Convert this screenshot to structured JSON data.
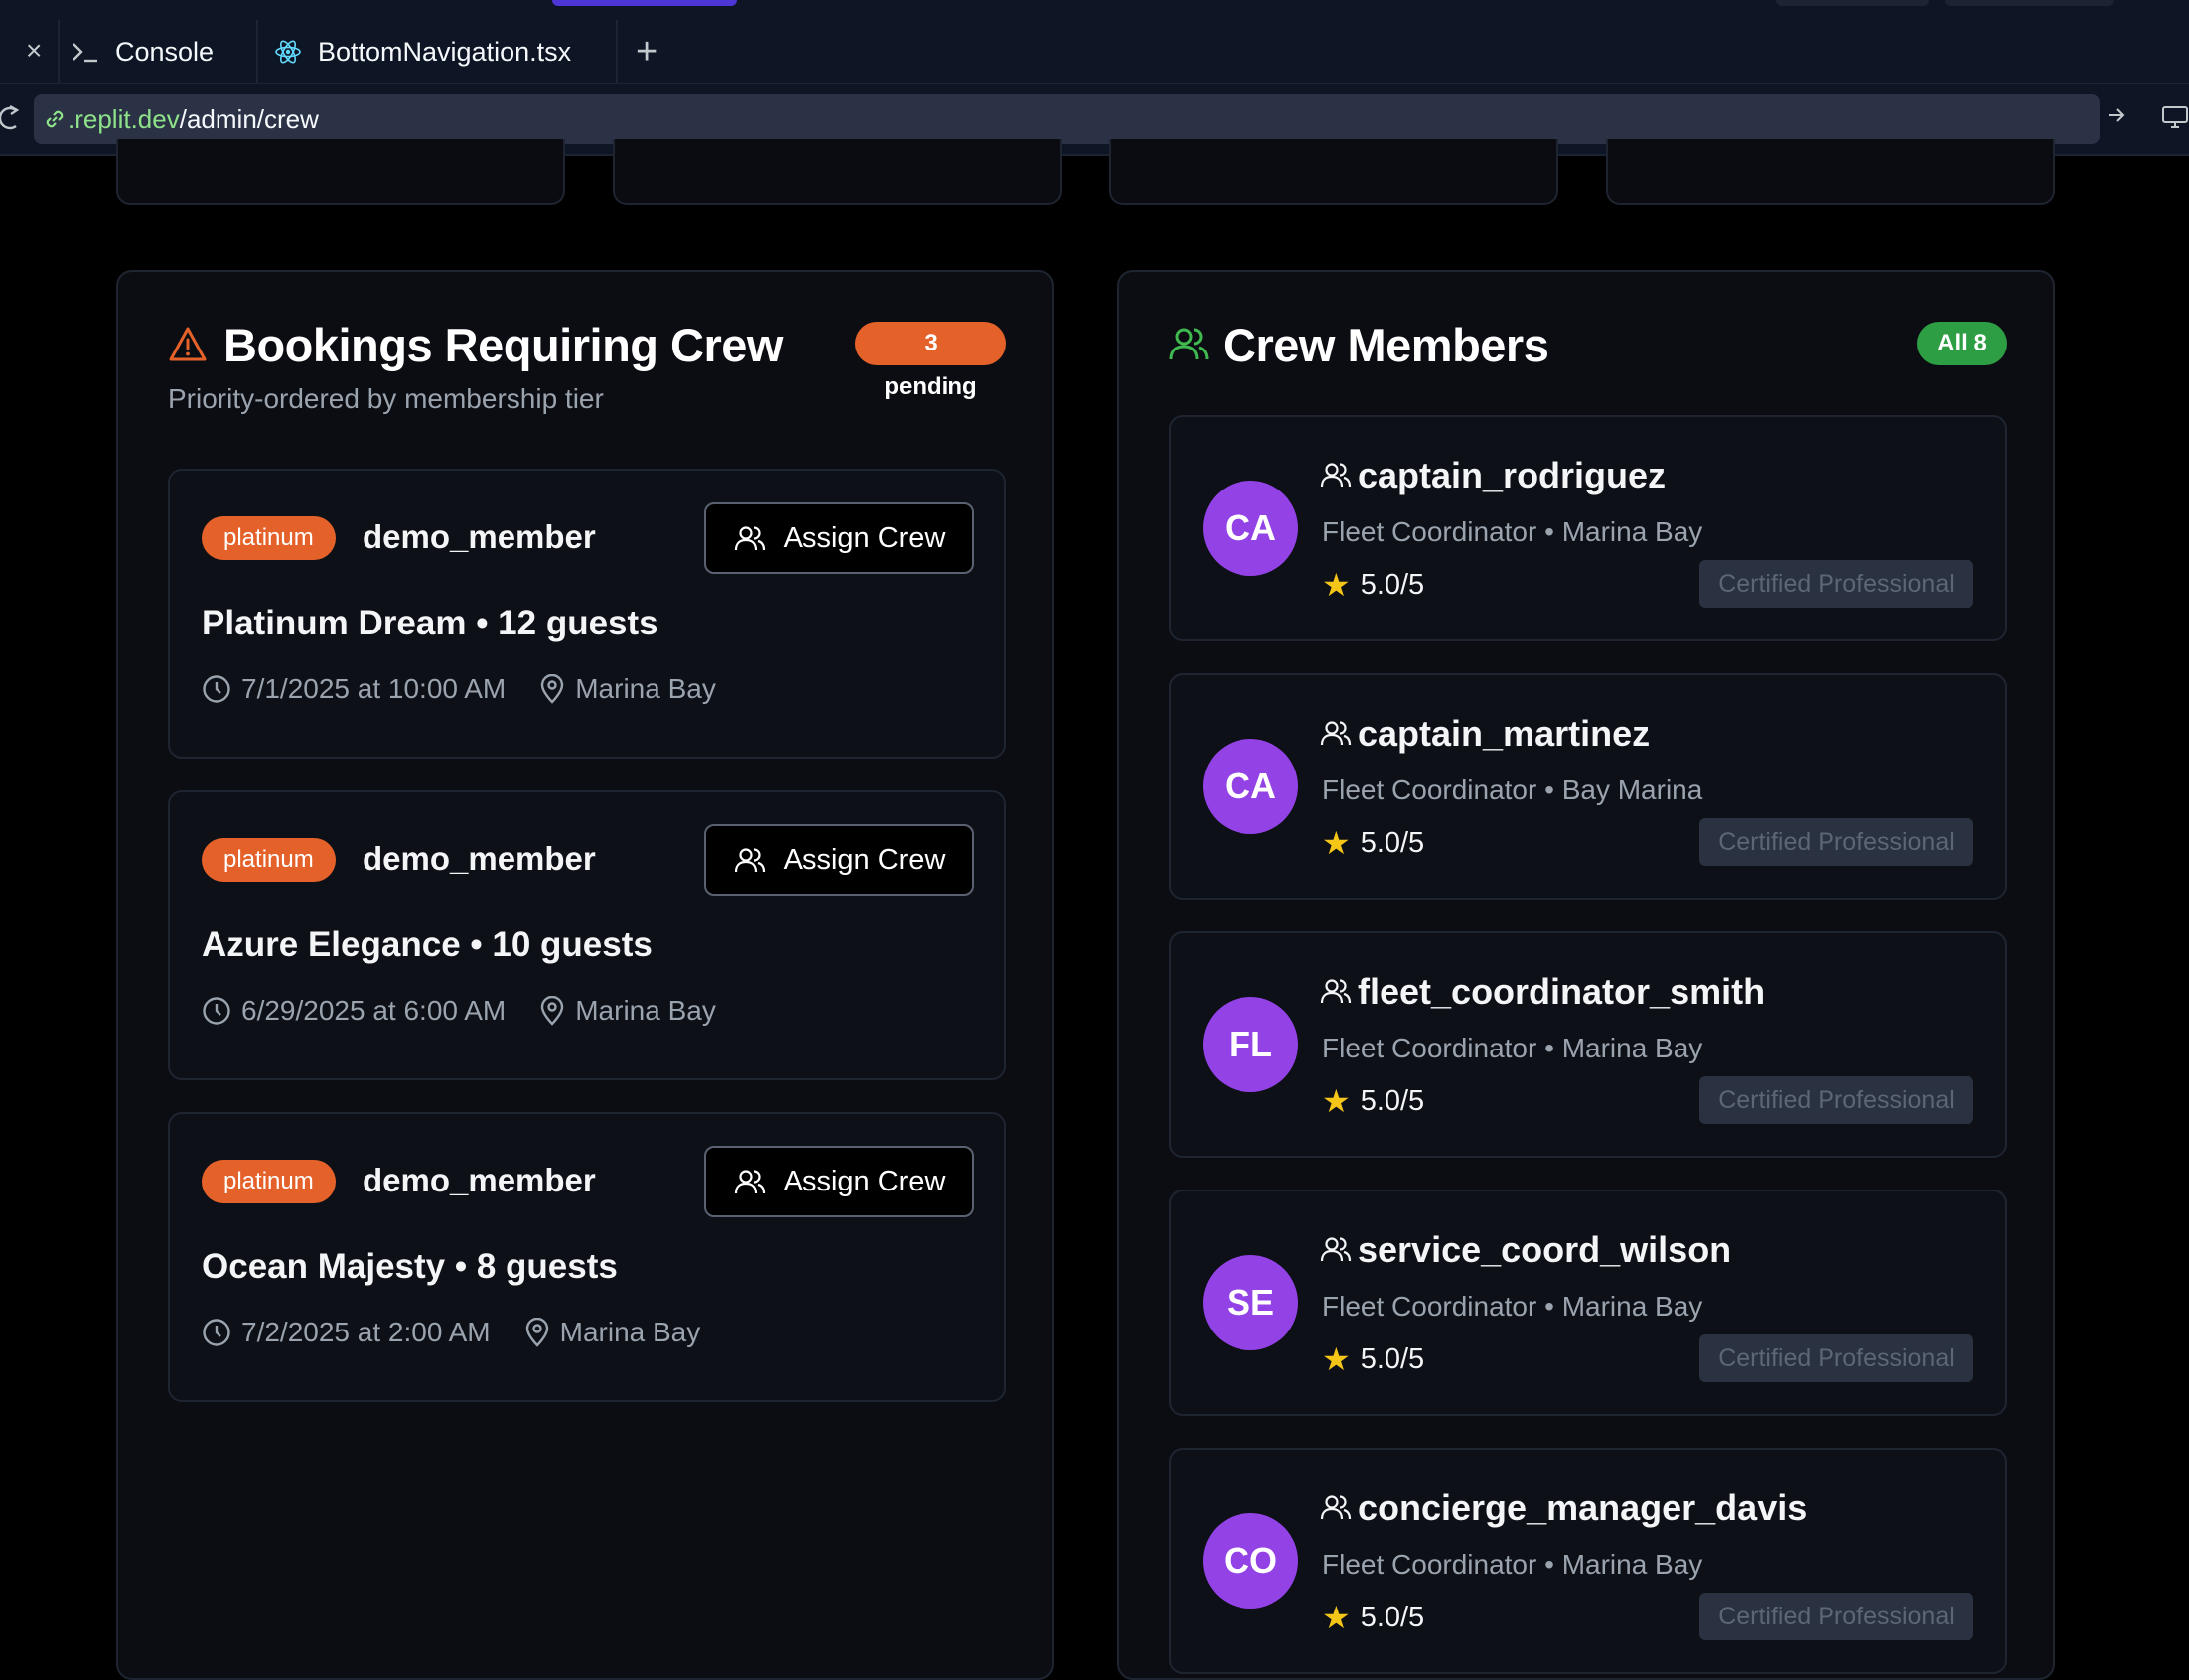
{
  "editor": {
    "tabs": [
      {
        "label": "Console",
        "icon": "terminal-icon"
      },
      {
        "label": "BottomNavigation.tsx",
        "icon": "react-icon"
      }
    ],
    "url": {
      "host": ".replit.dev",
      "path": "/admin/crew"
    }
  },
  "bookings": {
    "title": "Bookings Requiring Crew",
    "subtitle": "Priority-ordered by membership tier",
    "badge": "3 pending",
    "assign_label": "Assign Crew",
    "items": [
      {
        "tier": "platinum",
        "member": "demo_member",
        "title": "Platinum Dream • 12 guests",
        "datetime": "7/1/2025 at 10:00 AM",
        "location": "Marina Bay"
      },
      {
        "tier": "platinum",
        "member": "demo_member",
        "title": "Azure Elegance • 10 guests",
        "datetime": "6/29/2025 at 6:00 AM",
        "location": "Marina Bay"
      },
      {
        "tier": "platinum",
        "member": "demo_member",
        "title": "Ocean Majesty • 8 guests",
        "datetime": "7/2/2025 at 2:00 AM",
        "location": "Marina Bay"
      }
    ]
  },
  "crew": {
    "title": "Crew Members",
    "badge": "All 8",
    "cert_label": "Certified Professional",
    "members": [
      {
        "initials": "CA",
        "name": "captain_rodriguez",
        "role": "Fleet Coordinator • Marina Bay",
        "rating": "5.0/5"
      },
      {
        "initials": "CA",
        "name": "captain_martinez",
        "role": "Fleet Coordinator • Bay Marina",
        "rating": "5.0/5"
      },
      {
        "initials": "FL",
        "name": "fleet_coordinator_smith",
        "role": "Fleet Coordinator • Marina Bay",
        "rating": "5.0/5"
      },
      {
        "initials": "SE",
        "name": "service_coord_wilson",
        "role": "Fleet Coordinator • Marina Bay",
        "rating": "5.0/5"
      },
      {
        "initials": "CO",
        "name": "concierge_manager_davis",
        "role": "Fleet Coordinator • Marina Bay",
        "rating": "5.0/5"
      }
    ]
  },
  "colors": {
    "tier": "#e4622a",
    "pending": "#e4622a",
    "all": "#2e9e44",
    "avatar": "#9342e6",
    "warning": "#e4622a",
    "crew_icon": "#3fb950"
  }
}
